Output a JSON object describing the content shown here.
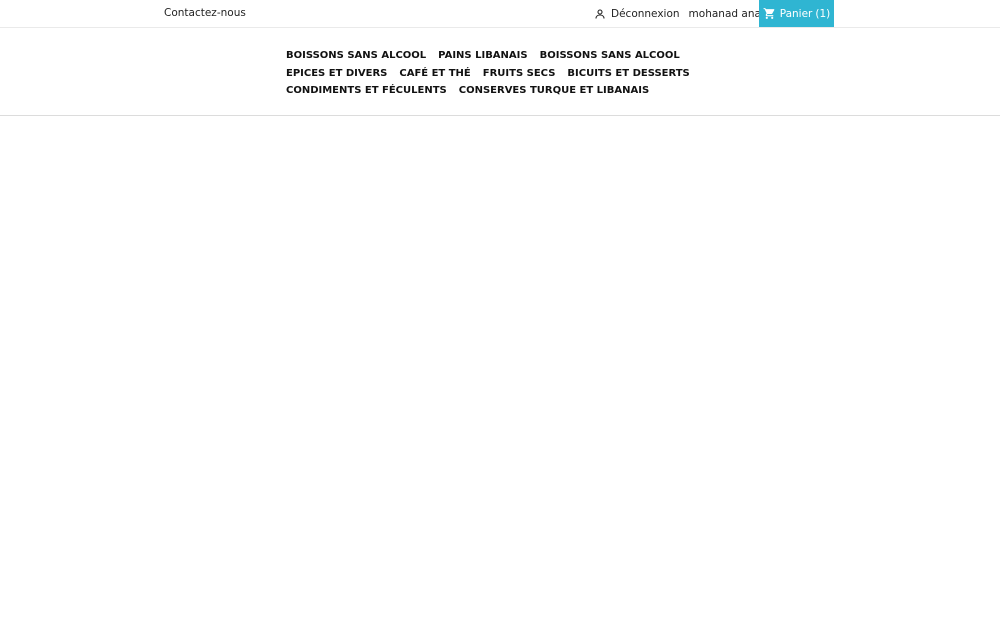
{
  "topbar": {
    "contact_label": "Contactez-nous",
    "logout_label": "Déconnexion",
    "account_name": "mohanad anan",
    "cart_label": "Panier",
    "cart_count": "(1)",
    "cart_color": "#2fb5d2"
  },
  "icons": {
    "user": "user-icon",
    "cart": "cart-icon"
  },
  "menu": {
    "rows": [
      [
        "BOISSONS SANS ALCOOL",
        "PAINS LIBANAIS",
        "BOISSONS SANS ALCOOL"
      ],
      [
        "EPICES ET DIVERS",
        "CAFÉ ET THÉ",
        "FRUITS SECS",
        "BICUITS ET DESSERTS"
      ],
      [
        "CONDIMENTS ET FÉCULENTS",
        "CONSERVES TURQUE ET LIBANAIS"
      ]
    ]
  }
}
